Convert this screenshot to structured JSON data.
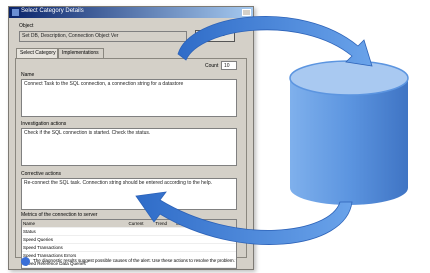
{
  "dialog": {
    "title": "Select Category Details",
    "object_label": "Object",
    "object_value": "Set DB, Description, Connection Object Ver",
    "browse_button": "Browse",
    "tabs": [
      {
        "label": "Select Category"
      },
      {
        "label": "Implementations"
      }
    ],
    "count_label": "Count",
    "count_value": "10",
    "sections": [
      {
        "label": "Name",
        "text": "Connect Task to the SQL connection, a connection string for a datastore"
      },
      {
        "label": "Investigation actions",
        "text": "Check if the SQL connection is started. Check the status."
      },
      {
        "label": "Corrective actions",
        "text": "Re-connect the SQL task. Connection string should be entered according to the help."
      }
    ],
    "table_title": "Metrics of the connection to server",
    "table_headers": [
      "Name",
      "Current",
      "Trend",
      "Limit"
    ],
    "table_rows": [
      [
        "Status",
        "",
        "",
        ""
      ],
      [
        "Speed Queries",
        "",
        "",
        ""
      ],
      [
        "Speed Transactions",
        "",
        "",
        ""
      ],
      [
        "Speed Transactions Errors",
        "",
        "",
        ""
      ],
      [
        "Speed Reference Data Queries",
        "",
        "",
        ""
      ]
    ],
    "info_text": "The diagnostic results suggest possible causes of the alert. Use these actions to resolve the problem."
  },
  "colors": {
    "arrow": "#3d7fd6",
    "cylinder": "#5c95e0",
    "cylinder_top": "#a9c9f1",
    "dialog_bg": "#d4d0c8",
    "titlebar": "#0a246a"
  }
}
